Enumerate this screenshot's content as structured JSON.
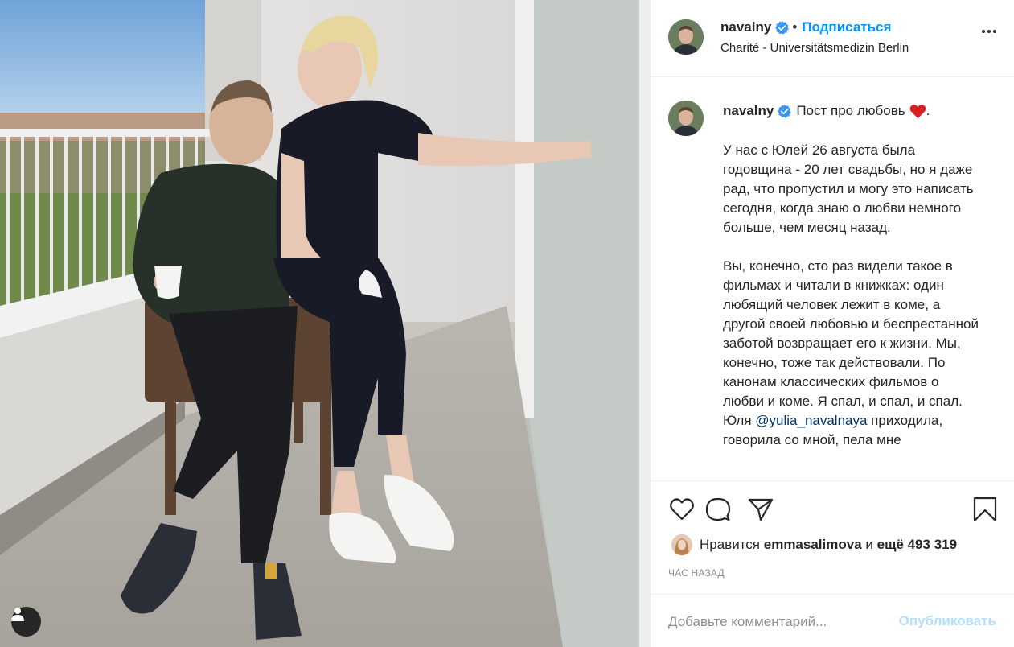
{
  "header": {
    "username": "navalny",
    "separator": "•",
    "follow_label": "Подписаться",
    "location": "Charité - Universitätsmedizin Berlin"
  },
  "caption": {
    "username": "navalny",
    "title": "Пост про любовь",
    "title_suffix": ".",
    "paragraph1": "У нас с Юлей 26 августа была годовщина - 20 лет свадьбы, но я даже рад, что пропустил и могу это написать сегодня, когда знаю о любви немного больше, чем месяц назад.",
    "paragraph2_part1": "Вы, конечно, сто раз видели такое в фильмах и читали в книжках: один любящий человек лежит в коме, а другой своей любовью и беспрестанной заботой возвращает его к жизни. Мы, конечно, тоже так действовали. По канонам классических фильмов о любви и коме. Я спал, и спал, и спал. Юля ",
    "mention": "@yulia_navalnaya",
    "paragraph2_part2": " приходила, говорила со мной, пела мне"
  },
  "likes": {
    "prefix": "Нравится",
    "user": "emmasalimova",
    "middle": "и",
    "count_text": "ещё 493 319"
  },
  "timestamp": "ЧАС НАЗАД",
  "comment": {
    "placeholder": "Добавьте комментарий...",
    "publish_label": "Опубликовать"
  },
  "icons": {
    "like": "heart-icon",
    "comment": "comment-icon",
    "share": "share-icon",
    "save": "bookmark-icon",
    "more": "more-options-icon",
    "verified": "verified-badge-icon",
    "tag": "tagged-user-icon"
  },
  "colors": {
    "accent": "#0095f6",
    "verified": "#3897f0",
    "publish_disabled": "#b2dffc",
    "meta_text": "#8e8e8e"
  }
}
